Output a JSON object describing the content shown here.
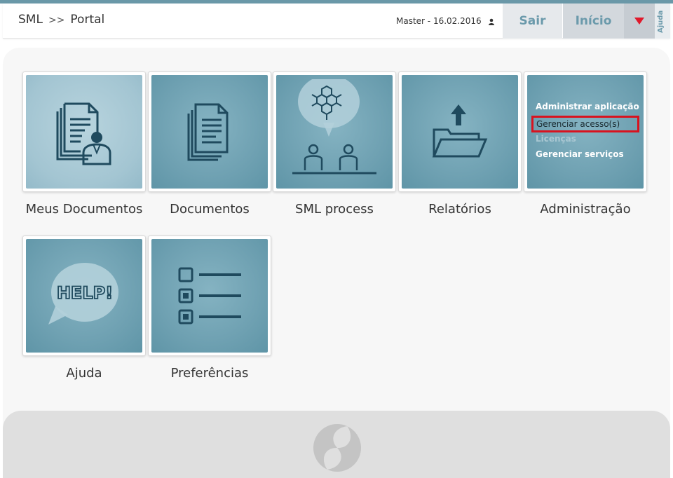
{
  "header": {
    "breadcrumb_root": "SML",
    "breadcrumb_sep": ">>",
    "breadcrumb_current": "Portal",
    "user_info": "Master - 16.02.2016",
    "sair_label": "Sair",
    "inicio_label": "Início",
    "ajuda_label": "Ajuda"
  },
  "tiles": [
    {
      "label": "Meus Documentos",
      "icon": "user-documents-icon"
    },
    {
      "label": "Documentos",
      "icon": "documents-icon"
    },
    {
      "label": "SML process",
      "icon": "molecule-meeting-icon"
    },
    {
      "label": "Relatórios",
      "icon": "folder-upload-icon"
    },
    {
      "label": "Administração",
      "icon": "admin-menu"
    },
    {
      "label": "Ajuda",
      "icon": "help-bubble-icon"
    },
    {
      "label": "Preferências",
      "icon": "checklist-icon"
    }
  ],
  "admin_menu": {
    "items": [
      "Administrar aplicação",
      "Gerenciar acesso(s)",
      "Licenças",
      "Gerenciar serviços"
    ]
  },
  "help_icon_text": "HELP!",
  "colors": {
    "tile": "#6fa1b2",
    "tile_light": "#a3c5d2",
    "accent": "#6b9aab",
    "highlight": "#d8131f",
    "menu_arrow": "#e0192b"
  }
}
